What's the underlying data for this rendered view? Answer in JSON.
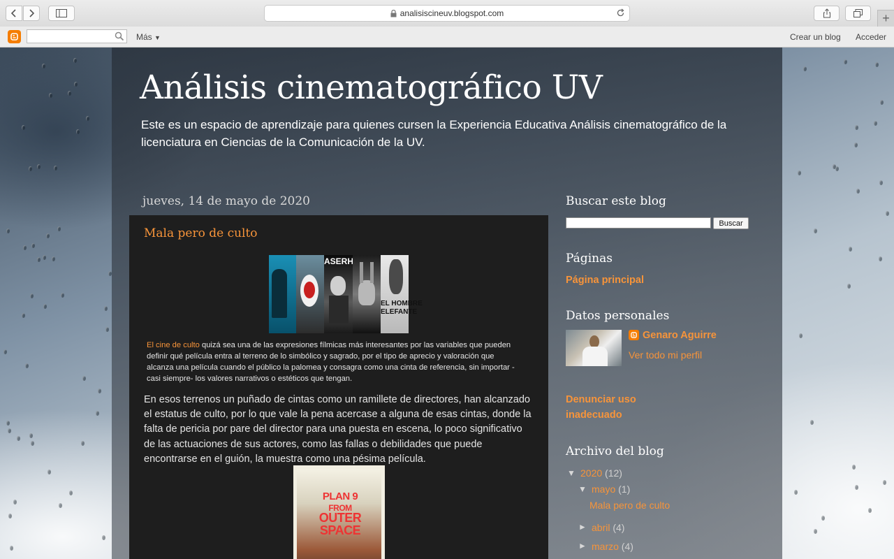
{
  "browser": {
    "url": "analisiscineuv.blogspot.com",
    "new_tab_symbol": "+"
  },
  "navbar": {
    "more_label": "Más",
    "create_blog": "Crear un blog",
    "sign_in": "Acceder"
  },
  "header": {
    "title": "Análisis cinematográfico UV",
    "description": "Este es un espacio de aprendizaje para quienes cursen la Experiencia Educativa Análisis cinematográfico de la licenciatura en Ciencias de la Comunicación de la UV."
  },
  "post": {
    "date": "jueves, 14 de mayo de 2020",
    "title": "Mala pero de culto",
    "image_words": [
      "ASERHEA",
      "EL HOMBRE",
      "ELEFANTE"
    ],
    "caption_link": "El cine de culto",
    "caption_rest": " quizá sea una de las expresiones fílmicas más interesantes por las variables que pueden definir qué película entra al terreno de lo simbólico y sagrado, por el tipo de aprecio y valoración que alcanza una película cuando el público la palomea y consagra como una cinta de referencia, sin importar -casi siempre- los valores narrativos o estéticos que tengan.",
    "body": "En esos terrenos un puñado de cintas como un ramillete de directores, han alcanzado el estatus de culto, por lo que vale la pena acercase a alguna de esas cintas, donde la falta de pericia por pare del director para una puesta en escena, lo poco significativo de las actuaciones de sus actores, como las fallas o debilidades que puede encontrarse en el guión, la muestra como una pésima película.",
    "poster_words": [
      "PLAN 9",
      "FROM",
      "OUTER",
      "SPACE"
    ]
  },
  "sidebar": {
    "search_heading": "Buscar este blog",
    "search_button": "Buscar",
    "pages_heading": "Páginas",
    "home_page": "Página principal",
    "profile_heading": "Datos personales",
    "profile_name": "Genaro Aguirre",
    "profile_link": "Ver todo mi perfil",
    "report_line1": "Denunciar uso",
    "report_line2": "inadecuado",
    "archive_heading": "Archivo del blog",
    "archive": {
      "year": "2020",
      "year_count": "(12)",
      "months": [
        {
          "label": "mayo",
          "count": "(1)",
          "expanded": true,
          "posts": [
            "Mala pero de culto"
          ]
        },
        {
          "label": "abril",
          "count": "(4)",
          "expanded": false
        },
        {
          "label": "marzo",
          "count": "(4)",
          "expanded": false
        }
      ],
      "expanded_symbol": "▼",
      "collapsed_symbol": "►"
    }
  },
  "colors": {
    "link_orange": "#f7943a",
    "post_bg": "#1e1e1e",
    "blogger_orange": "#f57d00"
  }
}
